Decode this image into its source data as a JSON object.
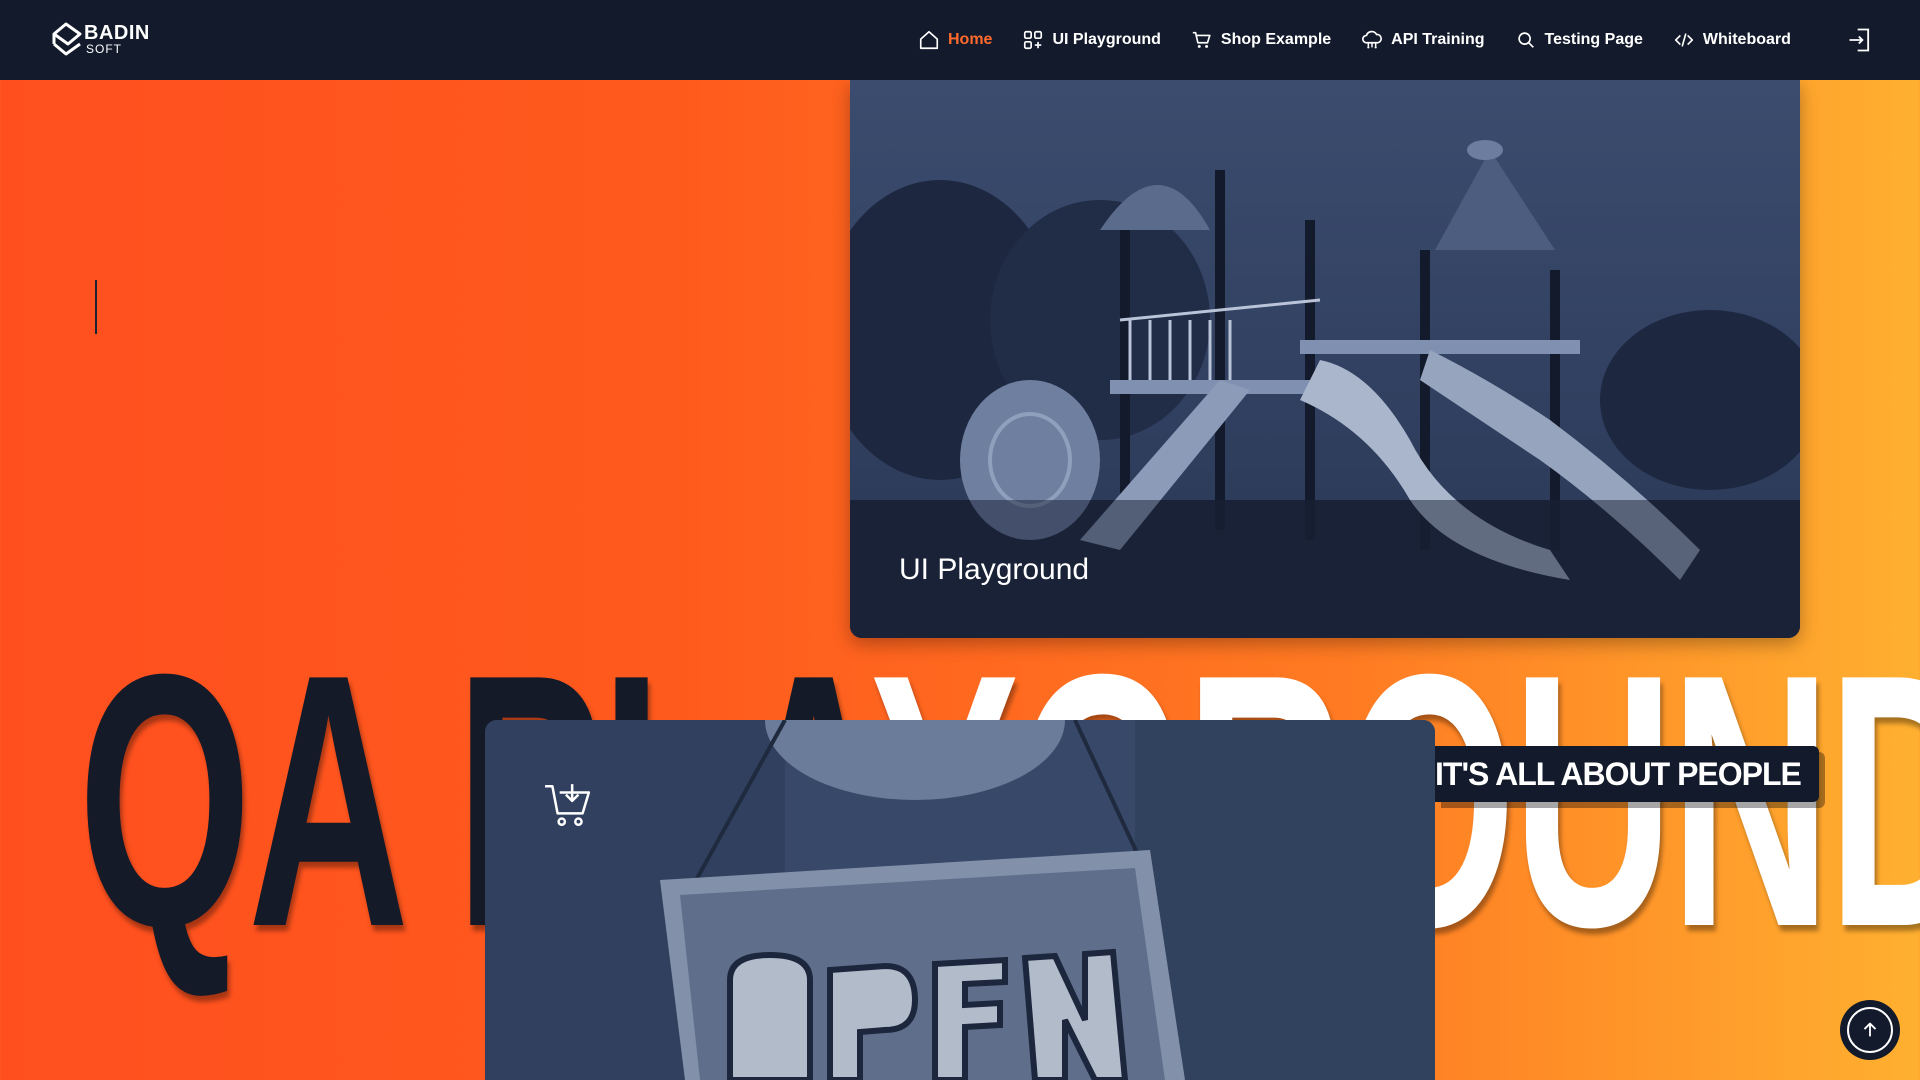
{
  "brand": {
    "name": "BADIN",
    "sub": "SOFT"
  },
  "nav": {
    "items": [
      {
        "label": "Home",
        "icon": "home-icon",
        "active": true
      },
      {
        "label": "UI Playground",
        "icon": "grid-plus-icon",
        "active": false
      },
      {
        "label": "Shop Example",
        "icon": "cart-icon",
        "active": false
      },
      {
        "label": "API Training",
        "icon": "cloud-network-icon",
        "active": false
      },
      {
        "label": "Testing Page",
        "icon": "search-icon",
        "active": false
      },
      {
        "label": "Whiteboard",
        "icon": "code-icon",
        "active": false
      }
    ],
    "login_icon": "login-door-icon",
    "active_color": "#ff6a2c"
  },
  "hero": {
    "title_dark": "QA PLA",
    "title_light": "YGROUND",
    "tagline": "IT'S ALL ABOUT PEOPLE"
  },
  "cards": {
    "playground": {
      "label": "UI Playground",
      "image": "playground-photo"
    },
    "shop": {
      "icon": "cart-download-icon",
      "image": "open-sign-photo"
    }
  },
  "scroll_top_icon": "arrow-up-icon",
  "colors": {
    "header_bg": "#121a2b",
    "accent": "#ff6a2c",
    "gradient_start": "#ff4f1f",
    "gradient_end": "#ffb030",
    "overlay": "#2a3a5c"
  }
}
